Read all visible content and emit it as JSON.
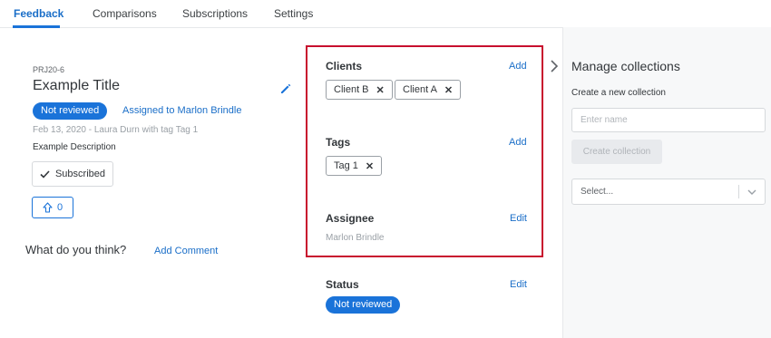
{
  "tabs": [
    {
      "label": "Feedback",
      "active": true
    },
    {
      "label": "Comparisons",
      "active": false
    },
    {
      "label": "Subscriptions",
      "active": false
    },
    {
      "label": "Settings",
      "active": false
    }
  ],
  "feedback": {
    "project_id": "PRJ20-6",
    "title": "Example Title",
    "status_pill": "Not reviewed",
    "assigned_link": "Assigned to Marlon Brindle",
    "meta": "Feb 13, 2020 - Laura Durn with tag Tag 1",
    "description": "Example Description",
    "subscribed_label": "Subscribed",
    "upvote_count": "0",
    "comment_prompt": "What do you think?",
    "add_comment_label": "Add Comment"
  },
  "details": {
    "clients": {
      "title": "Clients",
      "action": "Add",
      "chips": [
        "Client B",
        "Client A"
      ]
    },
    "tags": {
      "title": "Tags",
      "action": "Add",
      "chips": [
        "Tag 1"
      ]
    },
    "assignee": {
      "title": "Assignee",
      "action": "Edit",
      "value": "Marlon Brindle"
    },
    "status": {
      "title": "Status",
      "action": "Edit",
      "pill": "Not reviewed"
    }
  },
  "collections": {
    "title": "Manage collections",
    "create_label": "Create a new collection",
    "name_placeholder": "Enter name",
    "create_button": "Create collection",
    "select_placeholder": "Select..."
  },
  "colors": {
    "accent": "#1a73d9",
    "highlight_border": "#c8102e"
  }
}
